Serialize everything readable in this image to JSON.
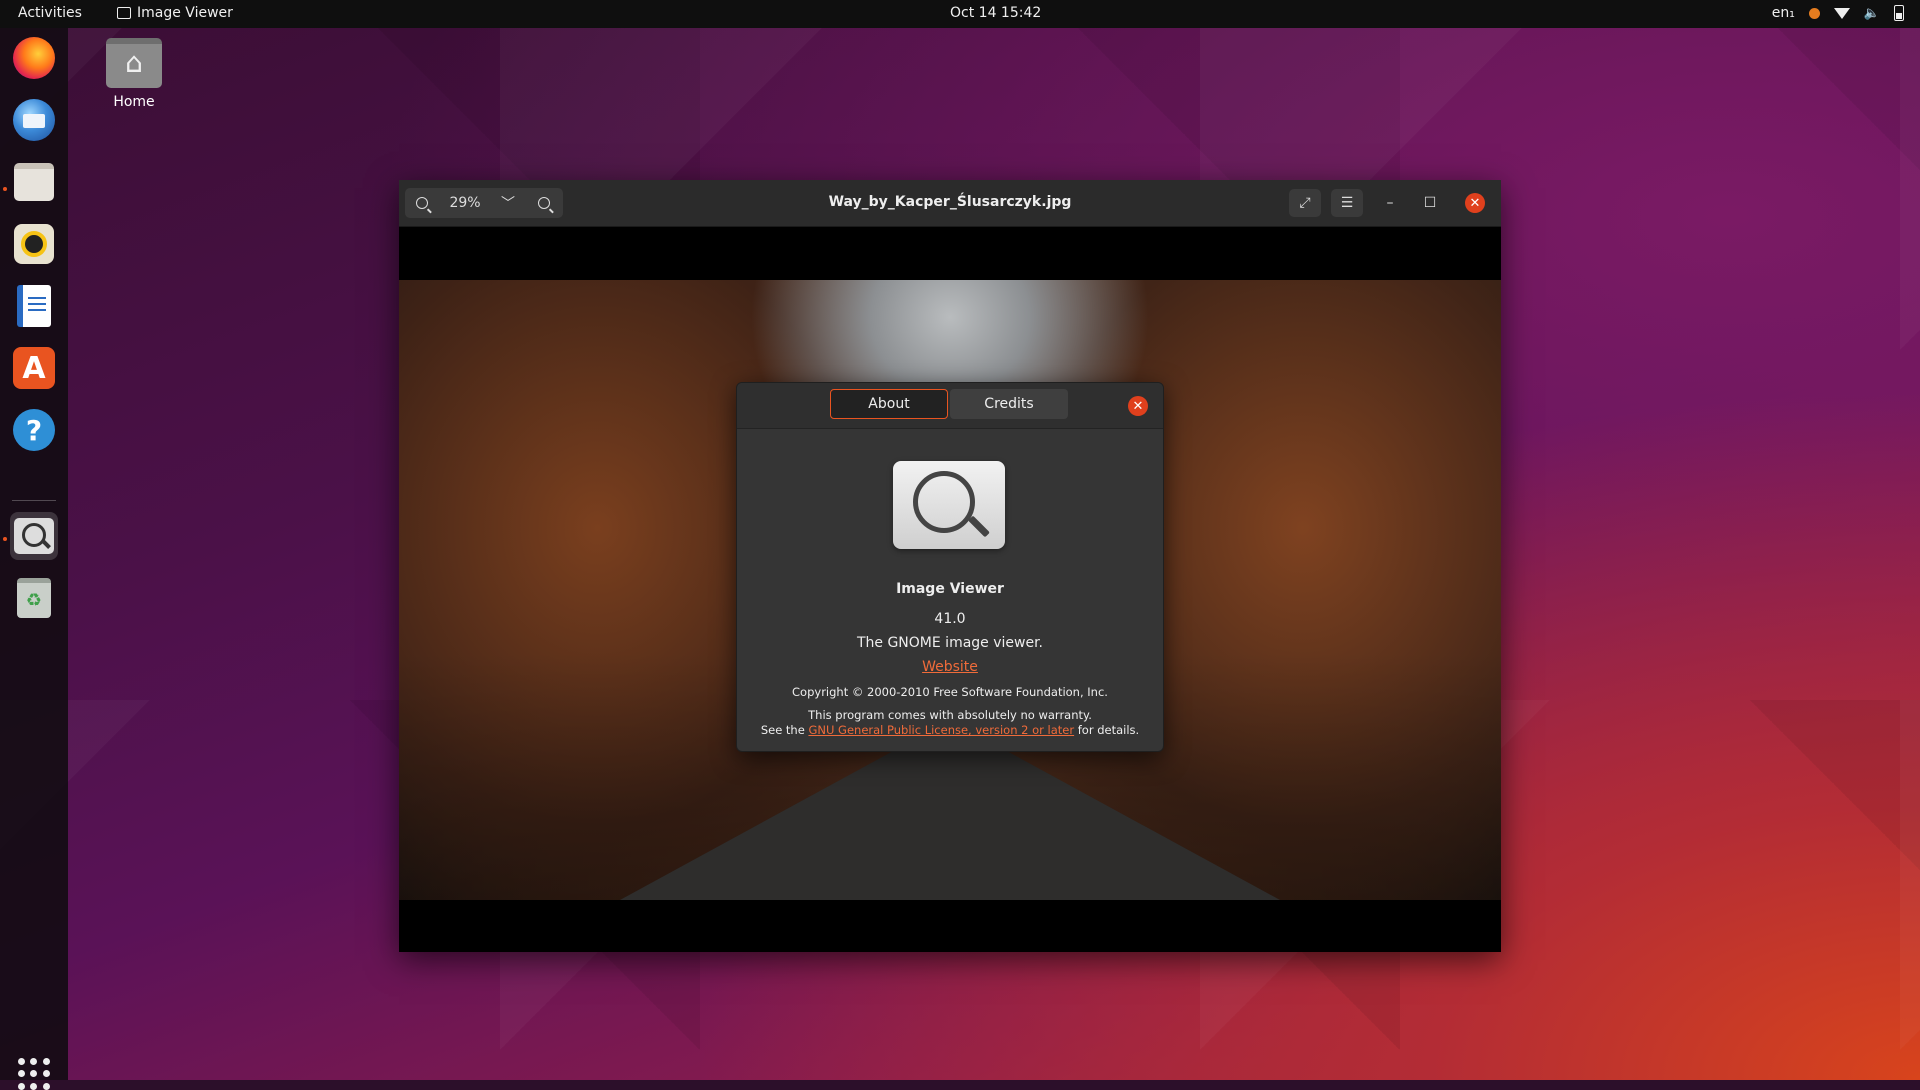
{
  "topbar": {
    "activities": "Activities",
    "app_name": "Image Viewer",
    "clock": "Oct 14  15:42",
    "input_lang": "en₁"
  },
  "desktop": {
    "home_label": "Home"
  },
  "window": {
    "title": "Way_by_Kacper_Ślusarczyk.jpg",
    "zoom_level": "29%"
  },
  "about": {
    "tabs": [
      "About",
      "Credits"
    ],
    "app_name": "Image Viewer",
    "version": "41.0",
    "comment": "The GNOME image viewer.",
    "website": "Website",
    "copyright": "Copyright © 2000-2010 Free Software Foundation, Inc.",
    "warranty_line1": "This program comes with absolutely no warranty.",
    "warranty_see": "See the ",
    "license_link": "GNU General Public License, version 2 or later",
    "warranty_after": " for details."
  },
  "colors": {
    "accent": "#e95420",
    "link": "#f06b3a"
  }
}
